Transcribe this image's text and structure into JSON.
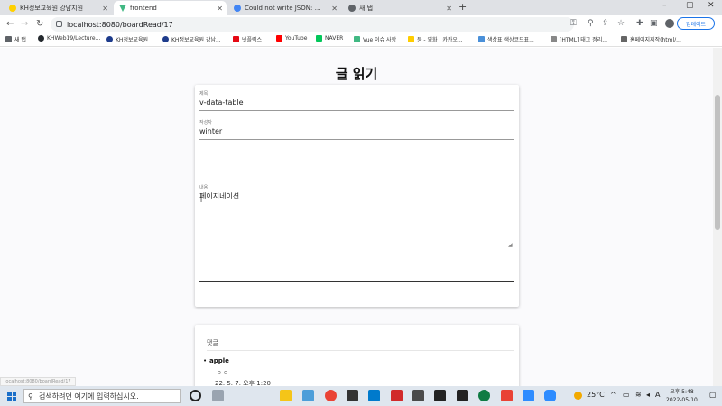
{
  "tabs": [
    {
      "title": "KH정보교육원 강남지원",
      "fav": "#ffd000"
    },
    {
      "title": "frontend",
      "fav": "#41b883"
    },
    {
      "title": "Could not write JSON: could no",
      "fav": "#4285f4"
    },
    {
      "title": "새 탭",
      "fav": "#5f6368"
    }
  ],
  "window": {
    "minimize": "–",
    "maximize": "▢",
    "close": "✕",
    "new_tab": "+"
  },
  "address": {
    "url": "localhost:8080/boardRead/17",
    "back": "←",
    "forward": "→",
    "reload": "↻",
    "update_label": "업데이트"
  },
  "right_icons": {
    "key": "⚿",
    "zoom": "⚲",
    "share": "⇪",
    "star": "☆",
    "ext": "✚",
    "side": "▣",
    "menu": "⋮"
  },
  "bookmarks": [
    {
      "label": "새 탭",
      "color": "#5f6368"
    },
    {
      "label": "KHWeb19/Lecture...",
      "color": "#24292e"
    },
    {
      "label": "KH정보교육원",
      "color": "#1e3c8c"
    },
    {
      "label": "KH정보교육원 강남...",
      "color": "#1e3c8c"
    },
    {
      "label": "넷플릭스",
      "color": "#e50914"
    },
    {
      "label": "YouTube",
      "color": "#ff0000"
    },
    {
      "label": "NAVER",
      "color": "#03c75a"
    },
    {
      "label": "Vue 이슈 사항",
      "color": "#41b883"
    },
    {
      "label": "듄 - 영화 | 카카오...",
      "color": "#ffcd00"
    },
    {
      "label": "색상표 색상코드표...",
      "color": "#4a90d9"
    },
    {
      "label": "[HTML] 태그 정리...",
      "color": "#888888"
    },
    {
      "label": "홈페이지제작(html/...",
      "color": "#666666"
    }
  ],
  "page": {
    "title": "글 읽기"
  },
  "form": {
    "title_label": "제목",
    "title_value": "v-data-table",
    "writer_label": "작성자",
    "writer_value": "winter",
    "content_label": "내용",
    "content_value": "페이지네이션",
    "cursor": "I",
    "resize": "◢"
  },
  "comments": {
    "title": "댓글",
    "items": [
      {
        "author": "apple",
        "body": "ㅇ ㅇ",
        "date": "22. 5. 7. 오후 1:20"
      }
    ]
  },
  "status": {
    "url": "localhost:8080/boardRead/17"
  },
  "taskbar": {
    "search_placeholder": "검색하려면 여기에 입력하십시오.",
    "search_icon": "⚲",
    "weather": "25°C",
    "time": "오후 5:48",
    "date": "2022-05-10",
    "apps": [
      "#f5c518",
      "#4c9ed9",
      "#ea4335",
      "#333333",
      "#007acc",
      "#d12a2a",
      "#4a4a4a",
      "#222222",
      "#0f7b43",
      "#e94235",
      "#2d8cff",
      "#2d2d2d"
    ]
  }
}
